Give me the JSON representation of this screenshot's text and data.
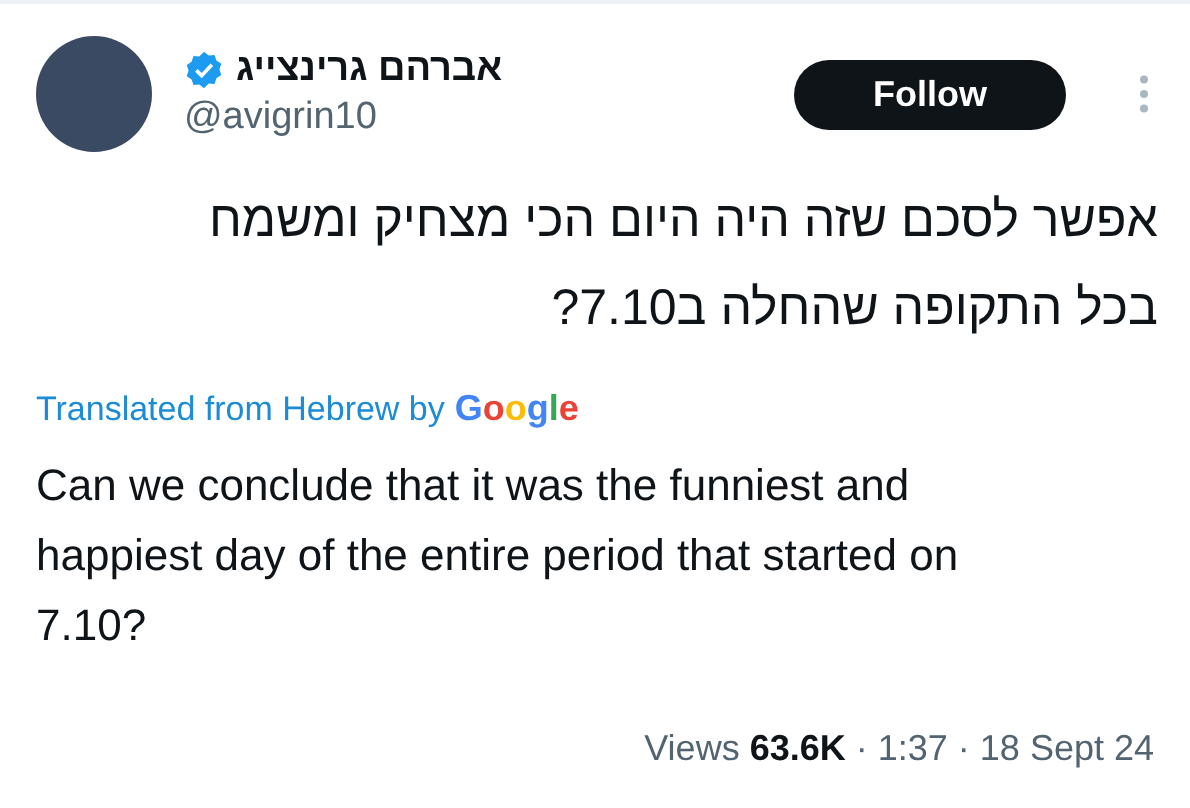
{
  "author": {
    "name": "אברהם גרינצייג",
    "verified": true,
    "handle": "@avigrin10"
  },
  "follow_button": {
    "label": "Follow"
  },
  "post": {
    "text": "אפשר לסכם שזה היה היום הכי מצחיק ומשמח בכל התקופה שהחלה ב7.10?",
    "translation_note": "Translated from Hebrew by",
    "translation_provider": "Google",
    "translated_text": "Can we conclude that it was the funniest and happiest day of the entire period that started on 7.10?"
  },
  "footer": {
    "views_label": "Views",
    "views_count": "63.6K",
    "dot_1": "·",
    "time": "1:37",
    "dot_2": "·",
    "date": "18 Sept 24"
  }
}
